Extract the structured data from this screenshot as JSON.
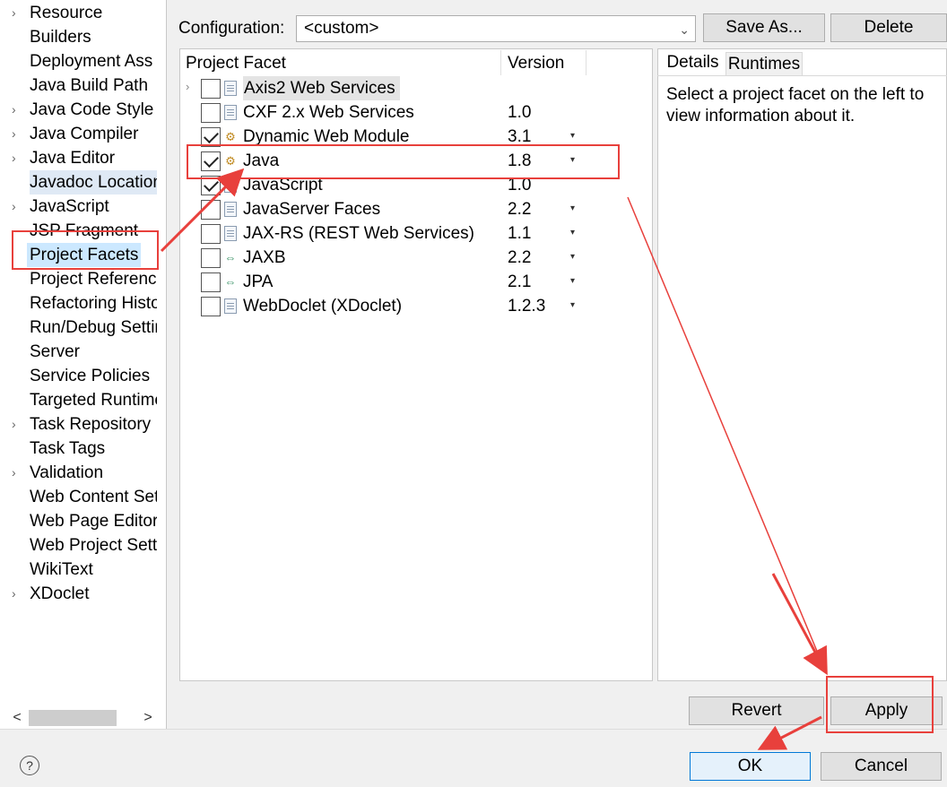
{
  "nav": {
    "items": [
      {
        "label": "Resource",
        "arrow": true
      },
      {
        "label": "Builders",
        "arrow": false
      },
      {
        "label": "Deployment Ass",
        "arrow": false
      },
      {
        "label": "Java Build Path",
        "arrow": false
      },
      {
        "label": "Java Code Style",
        "arrow": true
      },
      {
        "label": "Java Compiler",
        "arrow": true
      },
      {
        "label": "Java Editor",
        "arrow": true
      },
      {
        "label": "Javadoc Location",
        "arrow": false
      },
      {
        "label": "JavaScript",
        "arrow": true
      },
      {
        "label": "JSP Fragment",
        "arrow": false
      },
      {
        "label": "Project Facets",
        "arrow": false,
        "selected": true
      },
      {
        "label": "Project References",
        "arrow": false
      },
      {
        "label": "Refactoring History",
        "arrow": false
      },
      {
        "label": "Run/Debug Settings",
        "arrow": false
      },
      {
        "label": "Server",
        "arrow": false
      },
      {
        "label": "Service Policies",
        "arrow": false
      },
      {
        "label": "Targeted Runtimes",
        "arrow": false
      },
      {
        "label": "Task Repository",
        "arrow": true
      },
      {
        "label": "Task Tags",
        "arrow": false
      },
      {
        "label": "Validation",
        "arrow": true
      },
      {
        "label": "Web Content Settings",
        "arrow": false
      },
      {
        "label": "Web Page Editor",
        "arrow": false
      },
      {
        "label": "Web Project Settings",
        "arrow": false
      },
      {
        "label": "WikiText",
        "arrow": false
      },
      {
        "label": "XDoclet",
        "arrow": true
      }
    ],
    "arrow_glyph": "›",
    "scroll_left": "<",
    "scroll_right": ">"
  },
  "config": {
    "label": "Configuration:",
    "value": "<custom>",
    "chevron": "⌄",
    "save_as": "Save As...",
    "delete": "Delete"
  },
  "table": {
    "col_facet": "Project Facet",
    "col_version": "Version",
    "rows": [
      {
        "name": "Axis2 Web Services",
        "version": "",
        "checked": false,
        "icon": "doc",
        "expandable": true
      },
      {
        "name": "CXF 2.x Web Services",
        "version": "1.0",
        "checked": false,
        "icon": "doc",
        "dropdown": false
      },
      {
        "name": "Dynamic Web Module",
        "version": "3.1",
        "checked": true,
        "icon": "module",
        "dropdown": true
      },
      {
        "name": "Java",
        "version": "1.8",
        "checked": true,
        "icon": "module",
        "dropdown": true
      },
      {
        "name": "JavaScript",
        "version": "1.0",
        "checked": true,
        "icon": "doc",
        "dropdown": false
      },
      {
        "name": "JavaServer Faces",
        "version": "2.2",
        "checked": false,
        "icon": "doc",
        "dropdown": true
      },
      {
        "name": "JAX-RS (REST Web Services)",
        "version": "1.1",
        "checked": false,
        "icon": "doc",
        "dropdown": true
      },
      {
        "name": "JAXB",
        "version": "2.2",
        "checked": false,
        "icon": "arrow",
        "dropdown": true
      },
      {
        "name": "JPA",
        "version": "2.1",
        "checked": false,
        "icon": "arrow",
        "dropdown": true
      },
      {
        "name": "WebDoclet (XDoclet)",
        "version": "1.2.3",
        "checked": false,
        "icon": "doc",
        "dropdown": true
      }
    ],
    "dropdown_glyph": "▾",
    "expand_glyph": "›"
  },
  "details": {
    "tab_details": "Details",
    "tab_runtimes": "Runtimes",
    "text": "Select a project facet on the left to view information about it."
  },
  "buttons": {
    "revert": "Revert",
    "apply": "Apply",
    "ok": "OK",
    "cancel": "Cancel",
    "help": "?"
  },
  "colors": {
    "annotation": "#e8403c",
    "selection": "#cce8ff"
  }
}
